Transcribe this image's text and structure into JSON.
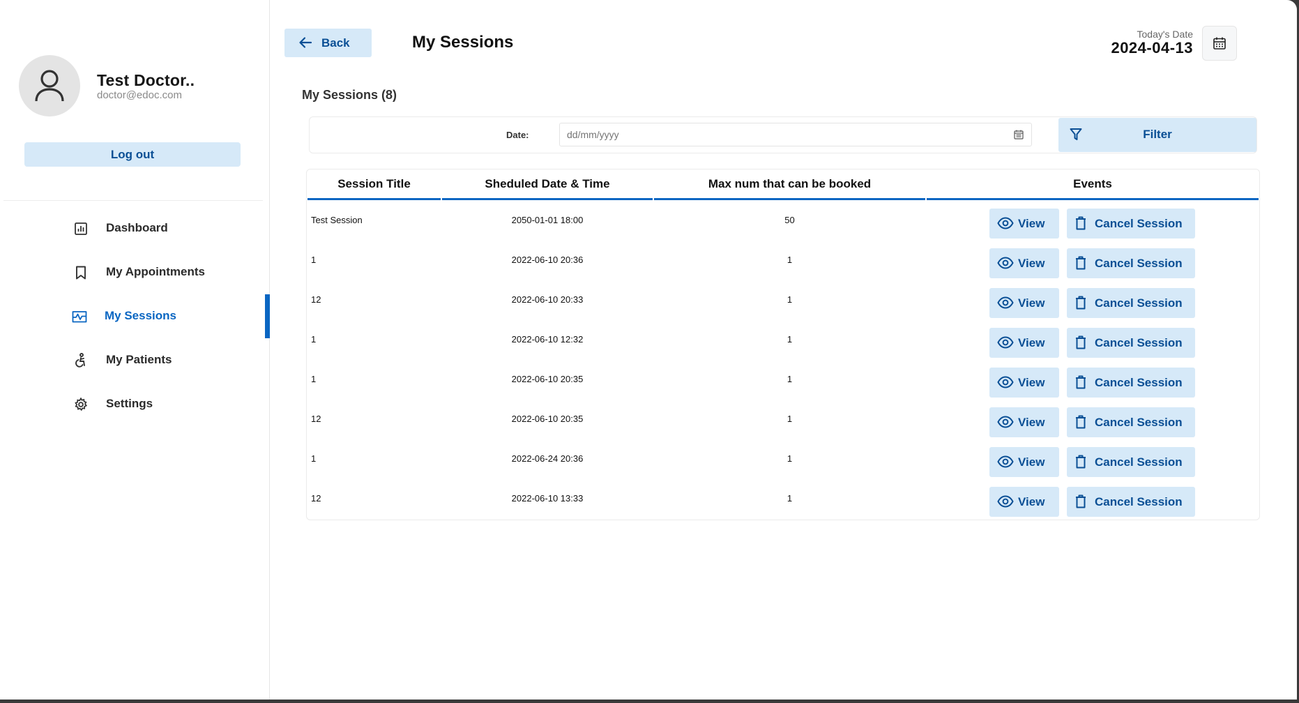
{
  "profile": {
    "name": "Test Doctor..",
    "email": "doctor@edoc.com",
    "logout_label": "Log out"
  },
  "sidebar": {
    "items": [
      {
        "label": "Dashboard",
        "icon": "dashboard-icon",
        "active": false
      },
      {
        "label": "My Appointments",
        "icon": "bookmark-icon",
        "active": false
      },
      {
        "label": "My Sessions",
        "icon": "sessions-icon",
        "active": true
      },
      {
        "label": "My Patients",
        "icon": "patient-icon",
        "active": false
      },
      {
        "label": "Settings",
        "icon": "gear-icon",
        "active": false
      }
    ]
  },
  "header": {
    "back_label": "Back",
    "title": "My Sessions",
    "today_label": "Today's Date",
    "today_value": "2024-04-13"
  },
  "main": {
    "heading": "My Sessions (8)",
    "filter": {
      "date_label": "Date:",
      "date_placeholder": "dd/mm/yyyy",
      "button_label": "Filter"
    },
    "table": {
      "headers": [
        "Session Title",
        "Sheduled Date & Time",
        "Max num that can be booked",
        "Events"
      ],
      "view_label": "View",
      "cancel_label": "Cancel Session",
      "rows": [
        {
          "title": "Test Session",
          "datetime": "2050-01-01 18:00",
          "max": "50"
        },
        {
          "title": "1",
          "datetime": "2022-06-10 20:36",
          "max": "1"
        },
        {
          "title": "12",
          "datetime": "2022-06-10 20:33",
          "max": "1"
        },
        {
          "title": "1",
          "datetime": "2022-06-10 12:32",
          "max": "1"
        },
        {
          "title": "1",
          "datetime": "2022-06-10 20:35",
          "max": "1"
        },
        {
          "title": "12",
          "datetime": "2022-06-10 20:35",
          "max": "1"
        },
        {
          "title": "1",
          "datetime": "2022-06-24 20:36",
          "max": "1"
        },
        {
          "title": "12",
          "datetime": "2022-06-10 13:33",
          "max": "1"
        }
      ]
    }
  },
  "colors": {
    "accent": "#0a66c2",
    "button_bg": "#d6e9f8",
    "button_text": "#0a4f95"
  }
}
